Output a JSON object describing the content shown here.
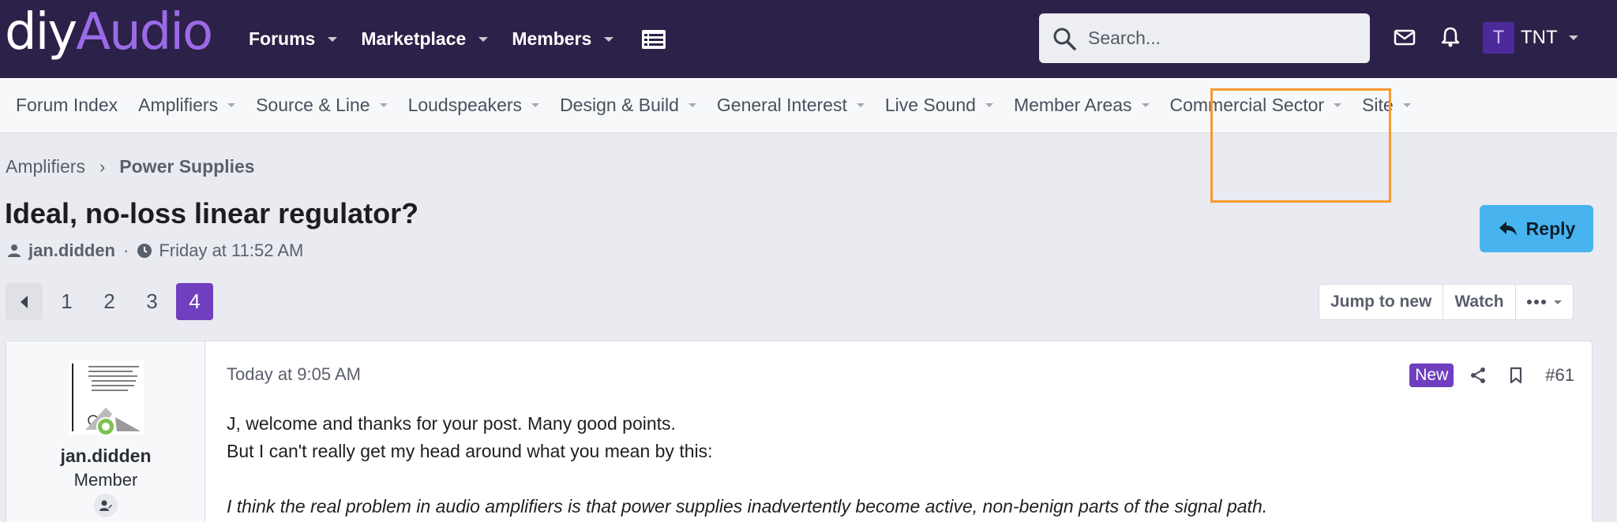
{
  "brand": {
    "part1": "diy",
    "part2": "Audio",
    "accent": "#9b6be6",
    "bar_color": "#2c2148"
  },
  "topnav": [
    {
      "label": "Forums"
    },
    {
      "label": "Marketplace"
    },
    {
      "label": "Members"
    }
  ],
  "search": {
    "placeholder": "Search..."
  },
  "user": {
    "initial": "T",
    "name": "TNT"
  },
  "subnav": [
    {
      "label": "Forum Index",
      "has_menu": false
    },
    {
      "label": "Amplifiers",
      "has_menu": true
    },
    {
      "label": "Source & Line",
      "has_menu": true
    },
    {
      "label": "Loudspeakers",
      "has_menu": true
    },
    {
      "label": "Design & Build",
      "has_menu": true
    },
    {
      "label": "General Interest",
      "has_menu": true
    },
    {
      "label": "Live Sound",
      "has_menu": true
    },
    {
      "label": "Member Areas",
      "has_menu": true
    },
    {
      "label": "Commercial Sector",
      "has_menu": true
    },
    {
      "label": "Site",
      "has_menu": true
    }
  ],
  "breadcrumb": {
    "parent": "Amplifiers",
    "current": "Power Supplies"
  },
  "thread": {
    "title": "Ideal, no-loss linear regulator?",
    "author": "jan.didden",
    "started": "Friday at 11:52 AM",
    "reply_label": "Reply"
  },
  "pagination": {
    "pages": [
      "1",
      "2",
      "3",
      "4"
    ],
    "current": "4"
  },
  "thread_tools": {
    "jump_to_new": "Jump to new",
    "watch": "Watch"
  },
  "post": {
    "username": "jan.didden",
    "role": "Member",
    "date": "Today at 9:05 AM",
    "badge": "New",
    "number": "#61",
    "lines": [
      "J, welcome and thanks for your post. Many good points.",
      "But I can't really get my head around what you mean by this:"
    ],
    "quote": "I think the real problem in audio amplifiers is that power supplies inadvertently become active, non-benign parts of the signal path."
  },
  "colors": {
    "reply_button": "#47b4f0",
    "active_page": "#6f3fbf",
    "highlight_box": "#f59a30",
    "online": "#7cc151"
  }
}
